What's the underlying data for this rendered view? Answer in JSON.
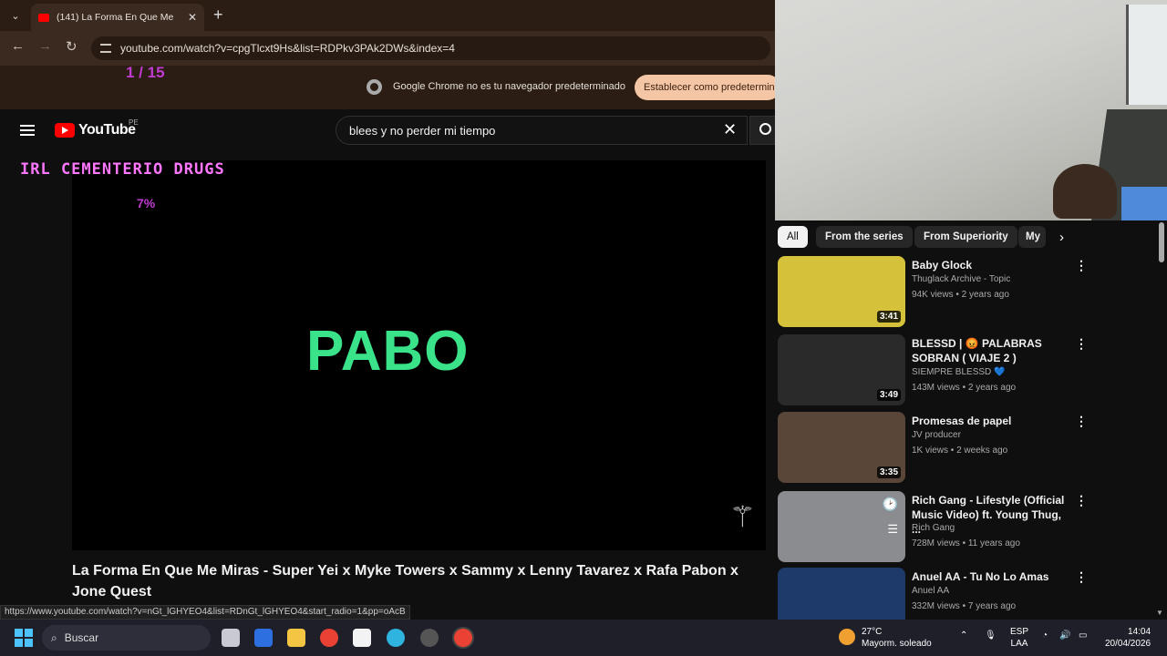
{
  "browser": {
    "tab_title": "(141) La Forma En Que Me",
    "url": "youtube.com/watch?v=cpgTlcxt9Hs&list=RDPkv3PAk2DWs&index=4",
    "infobar_text": "Google Chrome no es tu navegador predeterminado",
    "infobar_button": "Establecer como predetermin",
    "status_url": "https://www.youtube.com/watch?v=nGt_lGHYEO4&list=RDnGt_lGHYEO4&start_radio=1&pp=oAcB"
  },
  "overlay": {
    "counter": "1 / 15",
    "stream_title": "IRL CEMENTERIO DRUGS",
    "percent": "7%"
  },
  "youtube": {
    "logo_text": "YouTube",
    "country_code": "PE",
    "search_query": "blees y no perder mi tiempo"
  },
  "player": {
    "overlay_text": "PABO",
    "video_title": "La Forma En Que Me Miras - Super Yei x Myke Towers x Sammy x Lenny Tavarez x Rafa Pabon x Jone Quest"
  },
  "chips": [
    "All",
    "From the series",
    "From Superiority",
    "My"
  ],
  "recommendations": [
    {
      "title": "Baby Glock",
      "channel": "Thuglack Archive - Topic",
      "meta": "94K views • 2 years ago",
      "duration": "3:41",
      "thumb_color": "#d6c23a"
    },
    {
      "title": "BLESSD | 😡 PALABRAS SOBRAN ( VIAJE 2 )",
      "channel": "SIEMPRE BLESSD 💙",
      "meta": "143M views • 2 years ago",
      "duration": "3:49",
      "thumb_color": "#2a2a2a"
    },
    {
      "title": "Promesas de papel",
      "channel": "JV producer",
      "meta": "1K views • 2 weeks ago",
      "duration": "3:35",
      "thumb_color": "#5a4638"
    },
    {
      "title": "Rich Gang - Lifestyle (Official Music Video) ft. Young Thug, ...",
      "channel": "Rich Gang",
      "meta": "728M views • 11 years ago",
      "duration": "",
      "thumb_color": "#8a8c90"
    },
    {
      "title": "Anuel AA - Tu No Lo Amas",
      "channel": "Anuel AA",
      "meta": "332M views • 7 years ago",
      "duration": "",
      "thumb_color": "#1e3a6a"
    }
  ],
  "taskbar": {
    "search_label": "Buscar",
    "temperature": "27°C",
    "weather": "Mayorm. soleado",
    "lang1": "ESP",
    "lang2": "LAA",
    "time": "14:04",
    "date": "20/04/2026"
  }
}
